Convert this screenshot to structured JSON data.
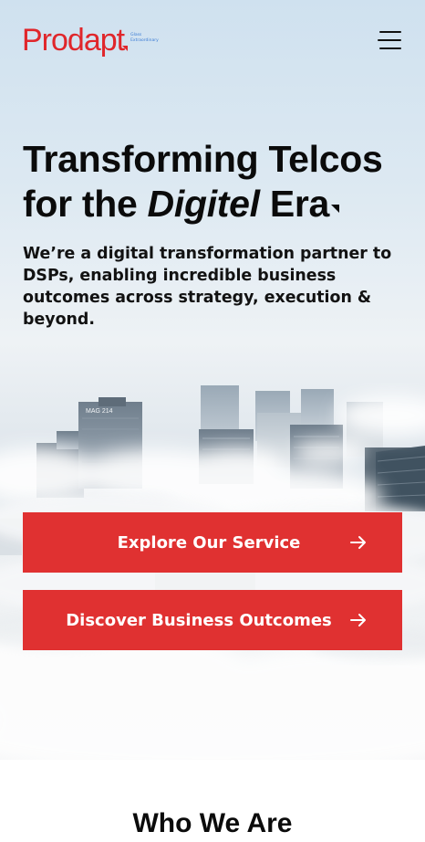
{
  "header": {
    "logo_text": "Prodapt",
    "logo_tagline": "Glass Extraordinary",
    "menu_label": "Menu"
  },
  "hero": {
    "headline_line1": "Transforming Telcos",
    "headline_for": "for the ",
    "headline_italic": "Digitel",
    "headline_end": " Era",
    "subheadline": "We’re a digital transformation partner to DSPs, enabling incredible business outcomes across strategy, execution & beyond.",
    "building_sign": "MAG 214",
    "buttons": [
      {
        "label": "Explore Our Service",
        "icon": "arrow-right-icon"
      },
      {
        "label": "Discover Business Outcomes",
        "icon": "arrow-right-icon"
      }
    ]
  },
  "next_section": {
    "title": "Who We Are"
  },
  "colors": {
    "brand_red": "#e0262b",
    "button_red": "#e03131",
    "text_dark": "#0b0b0b"
  }
}
